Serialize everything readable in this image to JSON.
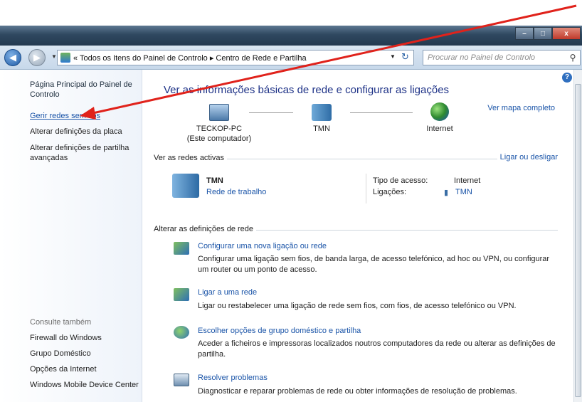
{
  "window": {
    "minimize": "–",
    "maximize": "□",
    "close": "x"
  },
  "navbar": {
    "back_icon": "back-arrow-icon",
    "forward_icon": "forward-arrow-icon",
    "breadcrumb": "« Todos os Itens do Painel de Controlo ▸ Centro de Rede e Partilha",
    "refresh_glyph": "↻",
    "search_placeholder": "Procurar no Painel de Controlo"
  },
  "sidebar": {
    "home": "Página Principal do Painel de Controlo",
    "links": [
      "Gerir redes sem fios",
      "Alterar definições da placa",
      "Alterar definições de partilha avançadas"
    ],
    "see_also_label": "Consulte também",
    "see_also": [
      "Firewall do Windows",
      "Grupo Doméstico",
      "Opções da Internet",
      "Windows Mobile Device Center"
    ]
  },
  "main": {
    "title": "Ver as informações básicas de rede e configurar as ligações",
    "map_link": "Ver mapa completo",
    "nodes": [
      {
        "name": "TECKOP-PC",
        "sub": "(Este computador)"
      },
      {
        "name": "TMN",
        "sub": ""
      },
      {
        "name": "Internet",
        "sub": ""
      }
    ],
    "active_label": "Ver as redes activas",
    "connect_link": "Ligar ou desligar",
    "active_network": {
      "name": "TMN",
      "type": "Rede de trabalho",
      "access_key": "Tipo de acesso:",
      "access_val": "Internet",
      "conn_key": "Ligações:",
      "conn_val": "TMN"
    },
    "change_label": "Alterar as definições de rede",
    "tasks": [
      {
        "title": "Configurar uma nova ligação ou rede",
        "desc": "Configurar uma ligação sem fios, de banda larga, de acesso telefónico, ad hoc ou VPN, ou configurar um router ou um ponto de acesso."
      },
      {
        "title": "Ligar a uma rede",
        "desc": "Ligar ou restabelecer uma ligação de rede sem fios, com fios, de acesso telefónico ou VPN."
      },
      {
        "title": "Escolher opções de grupo doméstico e partilha",
        "desc": "Aceder a ficheiros e impressoras localizados noutros computadores da rede ou alterar as definições de partilha."
      },
      {
        "title": "Resolver problemas",
        "desc": "Diagnosticar e reparar problemas de rede ou obter informações de resolução de problemas."
      }
    ]
  },
  "colors": {
    "link": "#1a54a8",
    "title": "#1e3287",
    "annotation_arrow": "#e0221b"
  }
}
